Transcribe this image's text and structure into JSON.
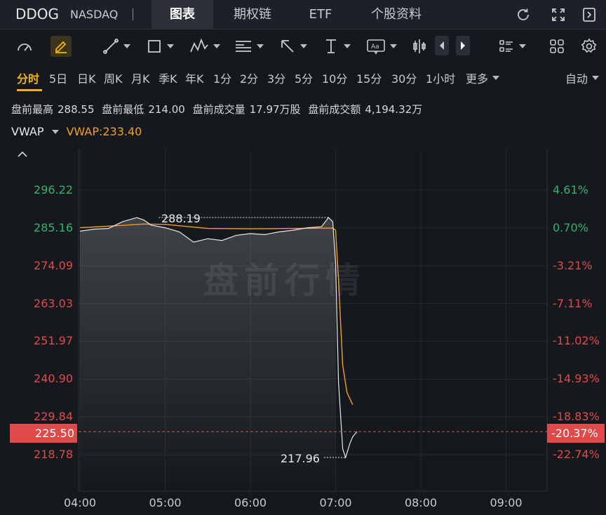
{
  "header": {
    "symbol": "DDOG",
    "exchange": "NASDAQ",
    "tabs": [
      {
        "label": "图表",
        "active": true
      },
      {
        "label": "期权链",
        "active": false
      },
      {
        "label": "ETF",
        "active": false
      },
      {
        "label": "个股资料",
        "active": false
      }
    ],
    "icons": [
      "refresh-icon",
      "fullscreen-icon",
      "collapse-panel-icon"
    ]
  },
  "toolbar": {
    "icons": [
      "indicator-icon",
      "draw-pen-icon",
      "trend-line-icon",
      "rectangle-icon",
      "pattern-icon",
      "fibonacci-icon",
      "arrow-icon",
      "vertical-line-icon",
      "text-annotation-icon",
      "candle-type-icon",
      "prev-icon",
      "next-icon",
      "layout-list-icon",
      "grid-layout-icon",
      "settings-icon"
    ]
  },
  "periods": {
    "items": [
      "分时",
      "5日",
      "日K",
      "周K",
      "月K",
      "季K",
      "年K",
      "1分",
      "2分",
      "3分",
      "5分",
      "10分",
      "15分",
      "30分",
      "1小时",
      "更多"
    ],
    "active": "分时",
    "scale_mode": "自动"
  },
  "stats": {
    "high_label": "盘前最高",
    "high": "288.55",
    "low_label": "盘前最低",
    "low": "214.00",
    "volume_label": "盘前成交量",
    "volume": "17.97万股",
    "turnover_label": "盘前成交额",
    "turnover": "4,194.32万"
  },
  "indicator": {
    "name": "VWAP",
    "value_label": "VWAP:233.40"
  },
  "chart": {
    "watermark": "盘前行情",
    "current_price": "225.50",
    "current_pct": "-20.37%",
    "high_annotation": "288.19",
    "low_annotation": "217.96",
    "colors": {
      "up": "#2fb36d",
      "down": "#e04a4a",
      "vwap": "#f0a020",
      "price_line": "#e6e8eb"
    }
  },
  "chart_data": {
    "type": "line",
    "y_ticks": [
      "296.22",
      "285.16",
      "274.09",
      "263.03",
      "251.97",
      "240.90",
      "229.84",
      "218.78"
    ],
    "pct_ticks": [
      "4.61%",
      "0.70%",
      "-3.21%",
      "-7.11%",
      "-11.02%",
      "-14.93%",
      "-18.83%",
      "-22.74%"
    ],
    "x_ticks": [
      "04:00",
      "05:00",
      "06:00",
      "07:00",
      "08:00",
      "09:00"
    ],
    "ylim": [
      218.78,
      296.22
    ],
    "series": [
      {
        "name": "price",
        "x": [
          "04:00",
          "04:10",
          "04:20",
          "04:30",
          "04:40",
          "04:45",
          "04:50",
          "05:00",
          "05:10",
          "05:20",
          "05:30",
          "05:40",
          "05:50",
          "06:00",
          "06:10",
          "06:20",
          "06:30",
          "06:40",
          "06:50",
          "06:55",
          "06:58",
          "07:00",
          "07:02",
          "07:05",
          "07:07",
          "07:10",
          "07:12",
          "07:15"
        ],
        "y": [
          284.2,
          284.8,
          285.0,
          287.0,
          288.19,
          287.5,
          286.0,
          285.2,
          284.0,
          281.0,
          282.0,
          281.5,
          283.0,
          283.5,
          283.2,
          284.0,
          284.5,
          285.2,
          285.5,
          288.2,
          287.0,
          275.0,
          240.0,
          220.5,
          217.96,
          222.0,
          224.0,
          225.5
        ]
      },
      {
        "name": "VWAP",
        "x": [
          "04:00",
          "04:30",
          "04:45",
          "05:00",
          "05:30",
          "06:00",
          "06:30",
          "06:58",
          "07:00",
          "07:02",
          "07:05",
          "07:08",
          "07:12"
        ],
        "y": [
          285.2,
          285.9,
          286.3,
          286.2,
          285.0,
          284.9,
          285.0,
          285.1,
          284.5,
          270.0,
          245.0,
          237.0,
          233.4
        ]
      }
    ]
  }
}
